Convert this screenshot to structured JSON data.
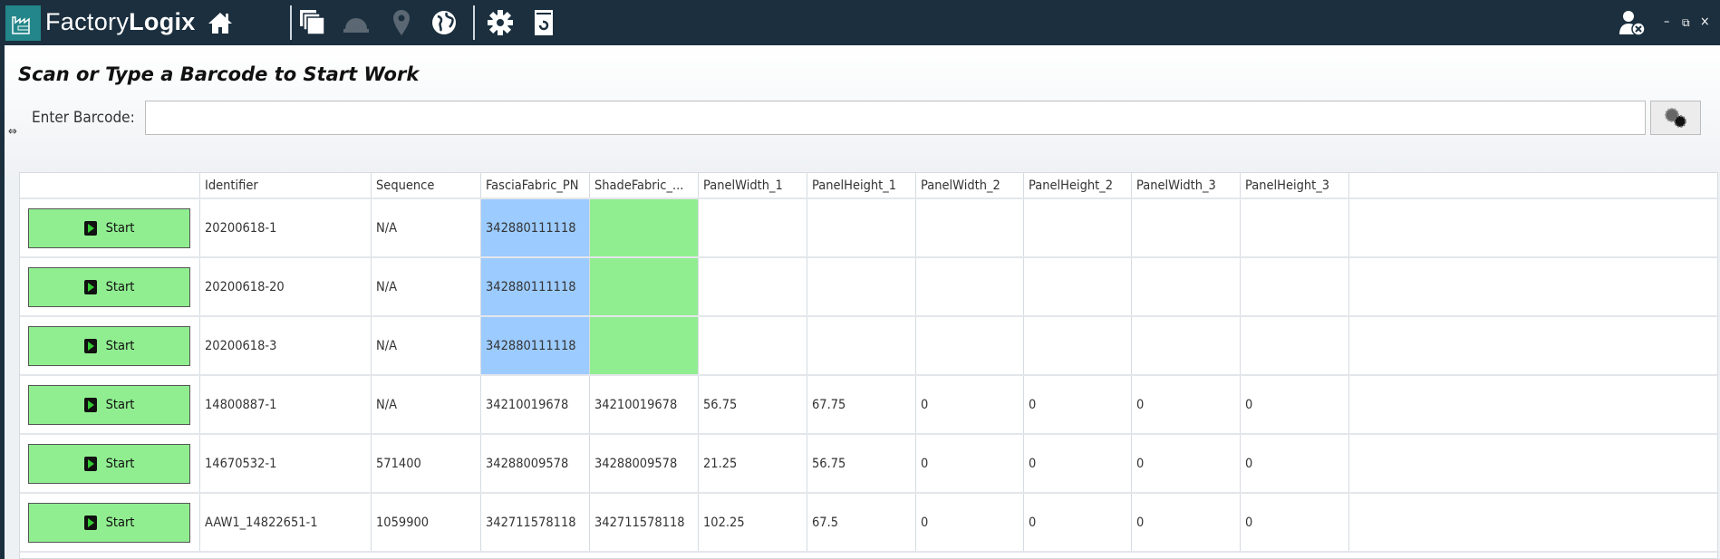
{
  "app": {
    "brand_light": "Factory",
    "brand_bold": "Logix",
    "toolbar_icons": [
      "home-icon",
      "windows-icon",
      "hardhat-icon",
      "location-pin-icon",
      "globe-icon",
      "gear-icon",
      "document-refresh-icon"
    ],
    "window_controls": [
      "minimize",
      "restore",
      "close"
    ]
  },
  "page": {
    "title": "Scan or Type a Barcode to Start Work",
    "barcode_label": "Enter Barcode:",
    "barcode_value": ""
  },
  "colors": {
    "fascia_highlight": "#9ccbff",
    "shade_highlight": "#90ee90",
    "start_button": "#90ee90",
    "topbar": "#1b2f3e"
  },
  "table": {
    "columns": [
      "",
      "Identifier",
      "Sequence",
      "FasciaFabric_PN",
      "ShadeFabric_...",
      "PanelWidth_1",
      "PanelHeight_1",
      "PanelWidth_2",
      "PanelHeight_2",
      "PanelWidth_3",
      "PanelHeight_3"
    ],
    "start_label": "Start",
    "rows": [
      {
        "cells": [
          "20200618-1",
          "N/A",
          "342880111118",
          "",
          "",
          "",
          "",
          "",
          "",
          ""
        ],
        "highlight": true
      },
      {
        "cells": [
          "20200618-20",
          "N/A",
          "342880111118",
          "",
          "",
          "",
          "",
          "",
          "",
          ""
        ],
        "highlight": true
      },
      {
        "cells": [
          "20200618-3",
          "N/A",
          "342880111118",
          "",
          "",
          "",
          "",
          "",
          "",
          ""
        ],
        "highlight": true
      },
      {
        "cells": [
          "14800887-1",
          "N/A",
          "34210019678",
          "34210019678",
          "56.75",
          "67.75",
          "0",
          "0",
          "0",
          "0"
        ],
        "highlight": false
      },
      {
        "cells": [
          "14670532-1",
          "571400",
          "34288009578",
          "34288009578",
          "21.25",
          "56.75",
          "0",
          "0",
          "0",
          "0"
        ],
        "highlight": false
      },
      {
        "cells": [
          "AAW1_14822651-1",
          "1059900",
          "342711578118",
          "342711578118",
          "102.25",
          "67.5",
          "0",
          "0",
          "0",
          "0"
        ],
        "highlight": false
      }
    ]
  }
}
